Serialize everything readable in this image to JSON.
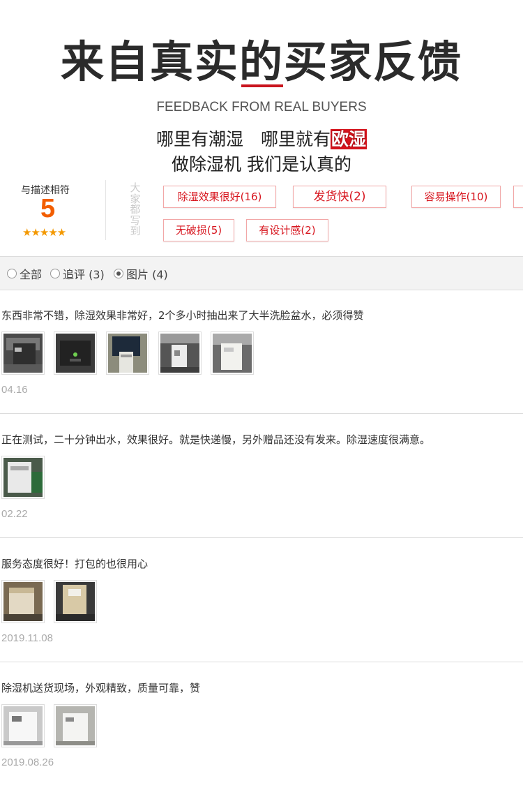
{
  "header": {
    "title": "来自真实的买家反馈",
    "subtitle": "FEEDBACK FROM REAL BUYERS",
    "slogan_line1_a": "哪里有潮湿　哪里就有",
    "slogan_line1_highlight": "欧湿",
    "slogan_line2": "做除湿机 我们是认真的"
  },
  "rating": {
    "label": "与描述相符",
    "score": "5",
    "stars": "★★★★★",
    "tags_label": "大家都写到"
  },
  "tags": [
    "除湿效果很好(16)",
    "发货快(2)",
    "容易操作(10)",
    "无破损(5)",
    "有设计感(2)"
  ],
  "filters": [
    {
      "label": "全部",
      "checked": false
    },
    {
      "label": "追评 (3)",
      "checked": false
    },
    {
      "label": "图片 (4)",
      "checked": true
    }
  ],
  "reviews": [
    {
      "text": "东西非常不错，除湿效果非常好，2个多小时抽出来了大半洗脸盆水，必须得赞",
      "date": "04.16",
      "photos": 5
    },
    {
      "text": "正在测试，二十分钟出水，效果很好。就是快递慢，另外赠品还没有发来。除湿速度很满意。",
      "date": "02.22",
      "photos": 1
    },
    {
      "text": "服务态度很好！打包的也很用心",
      "date": "2019.11.08",
      "photos": 2
    },
    {
      "text": "除湿机送货现场，外观精致，质量可靠，赞",
      "date": "2019.08.26",
      "photos": 2
    }
  ],
  "colors": {
    "accent": "#d7141d",
    "score": "#f25e00",
    "stars": "#f39800"
  }
}
